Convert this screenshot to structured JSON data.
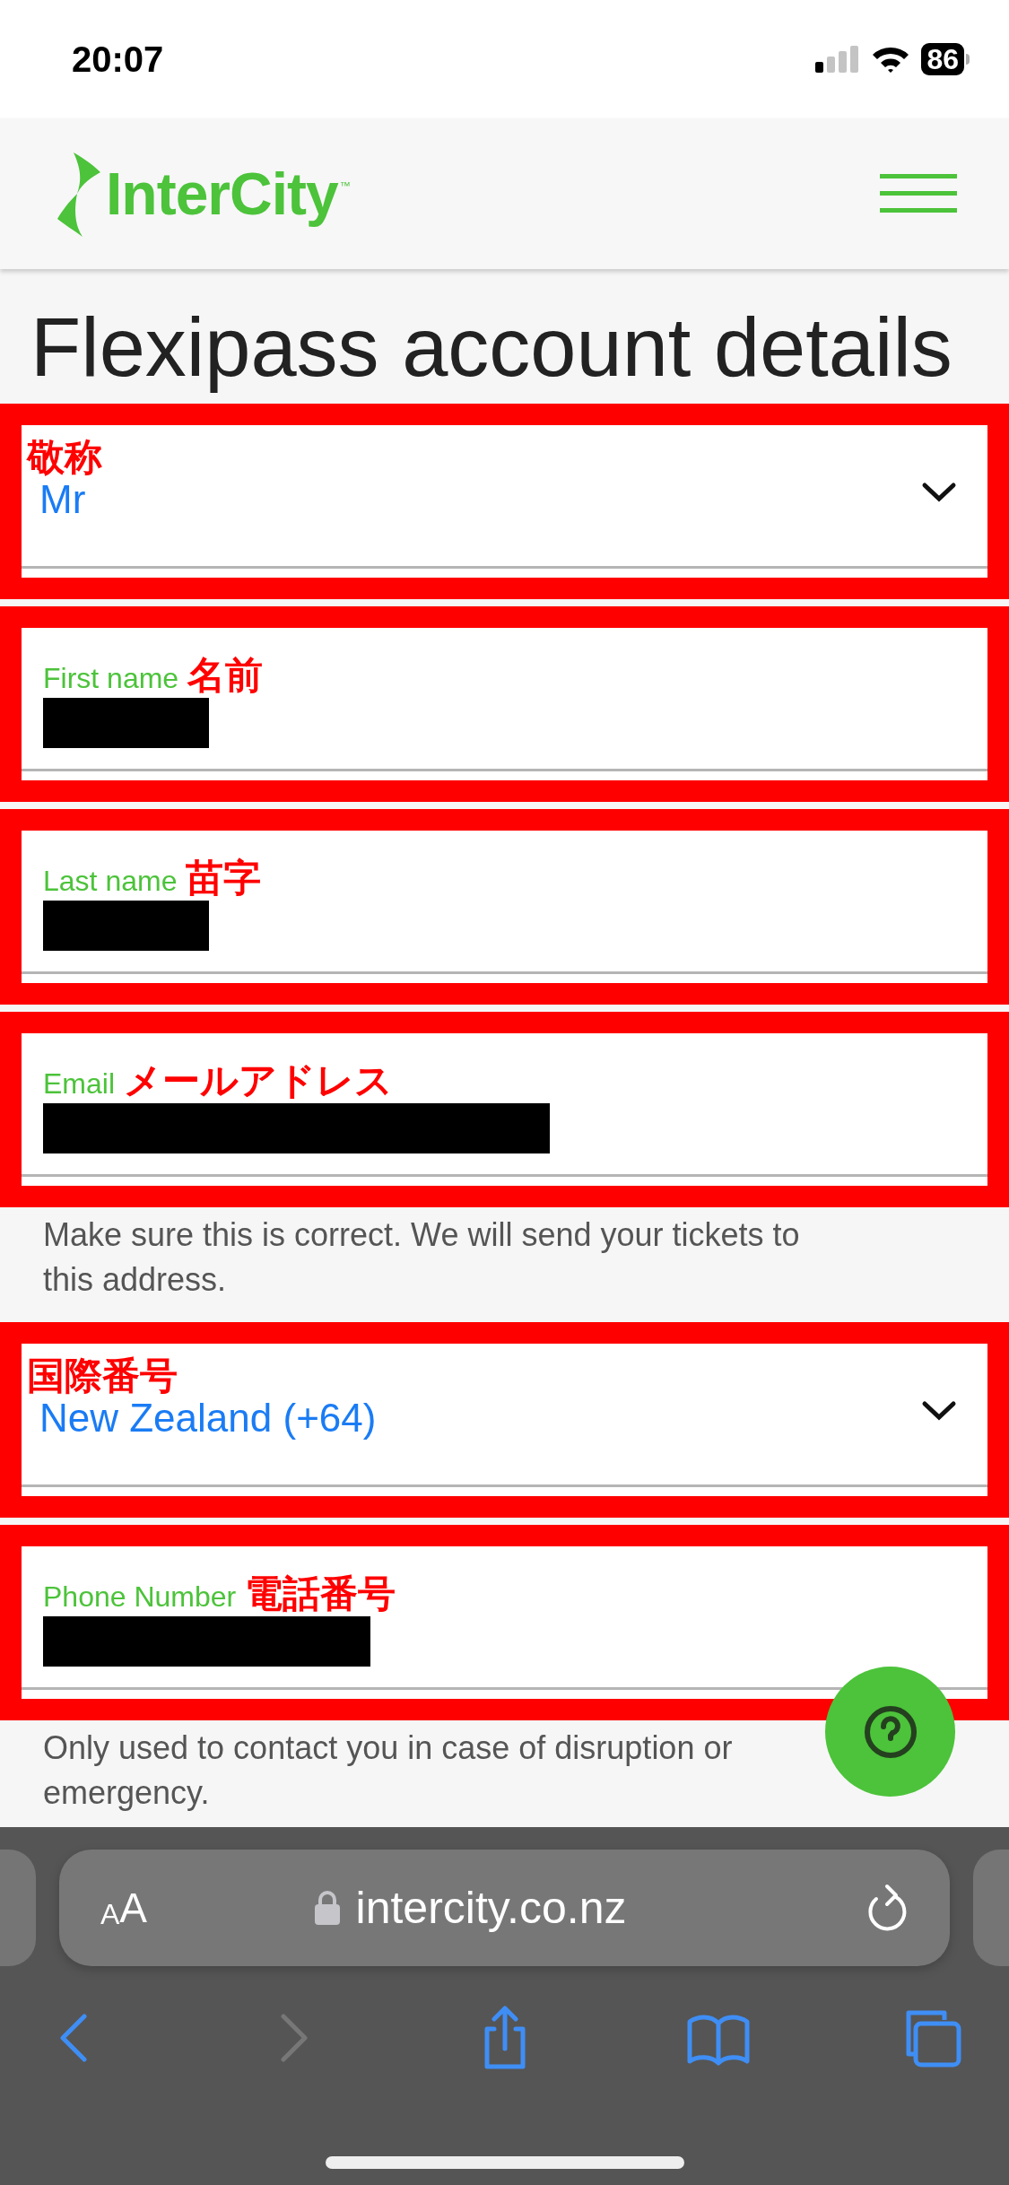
{
  "status_bar": {
    "time": "20:07",
    "battery": "86"
  },
  "header": {
    "logo": "InterCity",
    "logo_mark": "™"
  },
  "title": "Flexipass account details",
  "fields": [
    {
      "kind": "select",
      "annotation": "敬称",
      "value": "Mr"
    },
    {
      "kind": "text",
      "label": "First name",
      "annotation": "名前"
    },
    {
      "kind": "text",
      "label": "Last name",
      "annotation": "苗字"
    },
    {
      "kind": "text",
      "label": "Email",
      "annotation": "メールアドレス",
      "hint": "Make sure this is correct. We will send your tickets to this address."
    },
    {
      "kind": "select",
      "annotation": "国際番号",
      "value": "New Zealand (+64)"
    },
    {
      "kind": "text",
      "label": "Phone Number",
      "annotation": "電話番号",
      "hint": "Only used to contact you in case of disruption or emergency."
    }
  ],
  "browser": {
    "text_size": "AA",
    "url": "intercity.co.nz",
    "nav_buttons": [
      {
        "kind": "back",
        "disabled": false
      },
      {
        "kind": "forward",
        "disabled": true
      },
      {
        "kind": "share",
        "disabled": false
      },
      {
        "kind": "bookmarks",
        "disabled": false
      },
      {
        "kind": "tabs",
        "disabled": false
      }
    ]
  }
}
